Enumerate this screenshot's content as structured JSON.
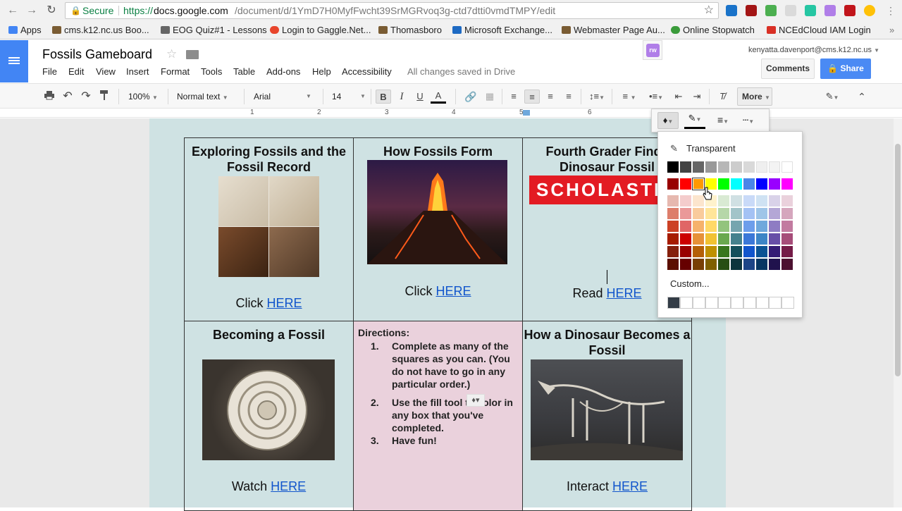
{
  "browser": {
    "url_secure_label": "Secure",
    "url_scheme": "https://",
    "url_host": "docs.google.com",
    "url_path": "/document/d/1YmD7H0MyfFwcht39SrMGRvoq3g-ctd7dtti0vmdTMPY/edit",
    "bookmarks": [
      {
        "label": "Apps",
        "color": "#4285f4"
      },
      {
        "label": "cms.k12.nc.us Boo...",
        "color": "#7a5c33"
      },
      {
        "label": "EOG Quiz#1 - Lessons",
        "color": "#666666"
      },
      {
        "label": "Login to Gaggle.Net...",
        "color": "#e8452c"
      },
      {
        "label": "Thomasboro",
        "color": "#7a5c33"
      },
      {
        "label": "Microsoft Exchange...",
        "color": "#1e6ac3"
      },
      {
        "label": "Webmaster Page Au...",
        "color": "#7a5c33"
      },
      {
        "label": "Online Stopwatch",
        "color": "#3a9b3a"
      },
      {
        "label": "NCEdCloud IAM Login",
        "color": "#d93025"
      }
    ]
  },
  "docs": {
    "title": "Fossils Gameboard",
    "menu": [
      "File",
      "Edit",
      "View",
      "Insert",
      "Format",
      "Tools",
      "Table",
      "Add-ons",
      "Help",
      "Accessibility"
    ],
    "save_status": "All changes saved in Drive",
    "account": "kenyatta.davenport@cms.k12.nc.us",
    "comments_label": "Comments",
    "share_label": "Share",
    "addon_label": "rw"
  },
  "toolbar": {
    "zoom": "100%",
    "style": "Normal text",
    "font": "Arial",
    "size": "14",
    "bold": "B",
    "italic": "I",
    "underline": "U",
    "text_color": "A",
    "more_label": "More"
  },
  "ruler": {
    "marks": [
      "1",
      "2",
      "3",
      "4",
      "5",
      "6"
    ]
  },
  "board": {
    "cells": [
      {
        "title": "Exploring Fossils and the Fossil Record",
        "prefix": "Click",
        "link": "HERE"
      },
      {
        "title": "How Fossils Form",
        "prefix": "Click",
        "link": "HERE"
      },
      {
        "title": "Fourth Grader Finds Dinosaur Fossil",
        "prefix": "Read",
        "link": "HERE",
        "logo_text": "SCHOLASTIC"
      },
      {
        "title": "Becoming a Fossil",
        "prefix": "Watch",
        "link": "HERE"
      },
      {
        "title": "How a Dinosaur Becomes a Fossil",
        "prefix": "Interact",
        "link": "HERE"
      }
    ],
    "directions": {
      "heading": "Directions:",
      "items": [
        {
          "num": "1.",
          "text": "Complete as many of the squares as you can. (You do not have to go in any particular order.)"
        },
        {
          "num": "2.",
          "text": "Use the fill tool        to color in any box that  you've completed."
        },
        {
          "num": "3.",
          "text": "Have fun!"
        }
      ]
    },
    "colors": {
      "page": "#cfe2e3",
      "directions_bg": "#ead1dc",
      "link": "#1155cc"
    }
  },
  "color_picker": {
    "transparent_label": "Transparent",
    "custom_label": "Custom...",
    "selected": "#ff9900",
    "rows": [
      [
        "#000000",
        "#434343",
        "#666666",
        "#999999",
        "#b7b7b7",
        "#cccccc",
        "#d9d9d9",
        "#efefef",
        "#f3f3f3",
        "#ffffff"
      ],
      [
        "#980000",
        "#ff0000",
        "#ff9900",
        "#ffff00",
        "#00ff00",
        "#00ffff",
        "#4a86e8",
        "#0000ff",
        "#9900ff",
        "#ff00ff"
      ],
      [
        "#e6b8af",
        "#f4cccc",
        "#fce5cd",
        "#fff2cc",
        "#d9ead3",
        "#d0e0e3",
        "#c9daf8",
        "#cfe2f3",
        "#d9d2e9",
        "#ead1dc"
      ],
      [
        "#dd7e6b",
        "#ea9999",
        "#f9cb9c",
        "#ffe599",
        "#b6d7a8",
        "#a2c4c9",
        "#a4c2f4",
        "#9fc5e8",
        "#b4a7d6",
        "#d5a6bd"
      ],
      [
        "#cc4125",
        "#e06666",
        "#f6b26b",
        "#ffd966",
        "#93c47d",
        "#76a5af",
        "#6d9eeb",
        "#6fa8dc",
        "#8e7cc3",
        "#c27ba0"
      ],
      [
        "#a61c00",
        "#cc0000",
        "#e69138",
        "#f1c232",
        "#6aa84f",
        "#45818e",
        "#3c78d8",
        "#3d85c6",
        "#674ea7",
        "#a64d79"
      ],
      [
        "#85200c",
        "#990000",
        "#b45f06",
        "#bf9000",
        "#38761d",
        "#134f5c",
        "#1155cc",
        "#0b5394",
        "#351c75",
        "#741b47"
      ],
      [
        "#5b0f00",
        "#660000",
        "#783f04",
        "#7f6000",
        "#274e13",
        "#0c343d",
        "#1c4587",
        "#073763",
        "#20124d",
        "#4c1130"
      ]
    ],
    "custom_first": "#333c46"
  }
}
